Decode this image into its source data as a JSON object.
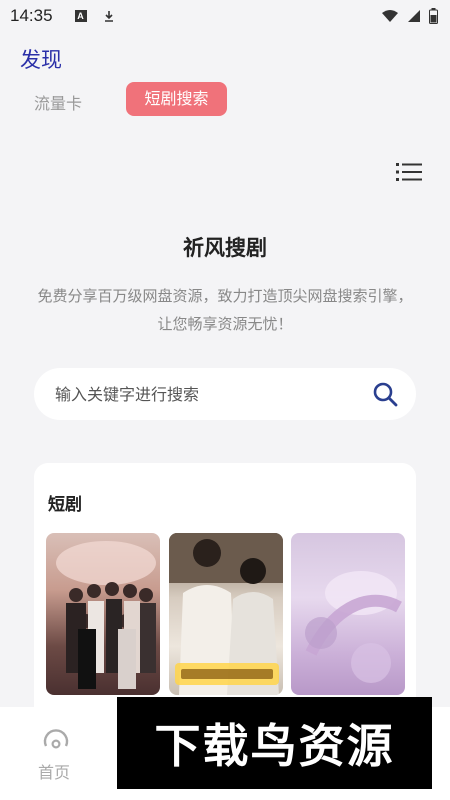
{
  "status_bar": {
    "time": "14:35",
    "icons": [
      "a-badge-icon",
      "download-icon",
      "wifi-icon",
      "signal-icon",
      "battery-icon"
    ]
  },
  "page": {
    "title": "发现"
  },
  "tabs": [
    {
      "label": "流量卡",
      "active": false
    },
    {
      "label": "短剧搜索",
      "active": true
    }
  ],
  "hero": {
    "title": "祈风搜剧",
    "description": "免费分享百万级网盘资源，致力打造顶尖网盘搜索引擎，让您畅享资源无忧！"
  },
  "search": {
    "placeholder": "输入关键字进行搜索"
  },
  "section": {
    "title": "短剧",
    "posters": [
      "poster-1",
      "poster-2",
      "poster-3"
    ]
  },
  "bottom_nav": {
    "items": [
      {
        "label": "首页",
        "icon": "home-gauge-icon"
      }
    ]
  },
  "watermark": {
    "text": "下载鸟资源"
  },
  "colors": {
    "accent": "#f0727a",
    "title_blue": "#2a2fa8",
    "search_icon": "#2a3f8f",
    "background": "#f4f4f6"
  }
}
